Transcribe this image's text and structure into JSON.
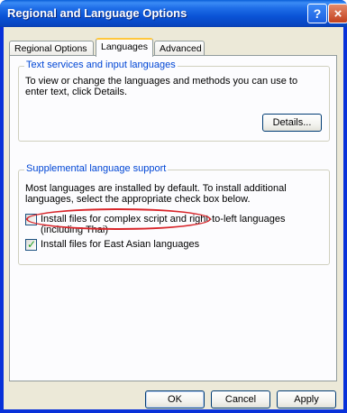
{
  "window": {
    "title": "Regional and Language Options",
    "help_glyph": "?",
    "close_glyph": "×"
  },
  "tabs": [
    {
      "label": "Regional Options",
      "active": false
    },
    {
      "label": "Languages",
      "active": true
    },
    {
      "label": "Advanced",
      "active": false
    }
  ],
  "text_services": {
    "title": "Text services and input languages",
    "description": "To view or change the languages and methods you can use to enter text, click Details.",
    "details_button": "Details..."
  },
  "supplemental": {
    "title": "Supplemental language support",
    "description": "Most languages are installed by default. To install additional languages, select the appropriate check box below.",
    "checkboxes": [
      {
        "label": "Install files for complex script and right-to-left languages (including Thai)",
        "checked": false
      },
      {
        "label": "Install files for East Asian languages",
        "checked": true
      }
    ]
  },
  "buttons": {
    "ok": "OK",
    "cancel": "Cancel",
    "apply": "Apply"
  },
  "colors": {
    "title_bar": "#0a53d6",
    "dialog_bg": "#ece9d8",
    "group_title": "#0046d5",
    "annotation": "#d8262b"
  }
}
